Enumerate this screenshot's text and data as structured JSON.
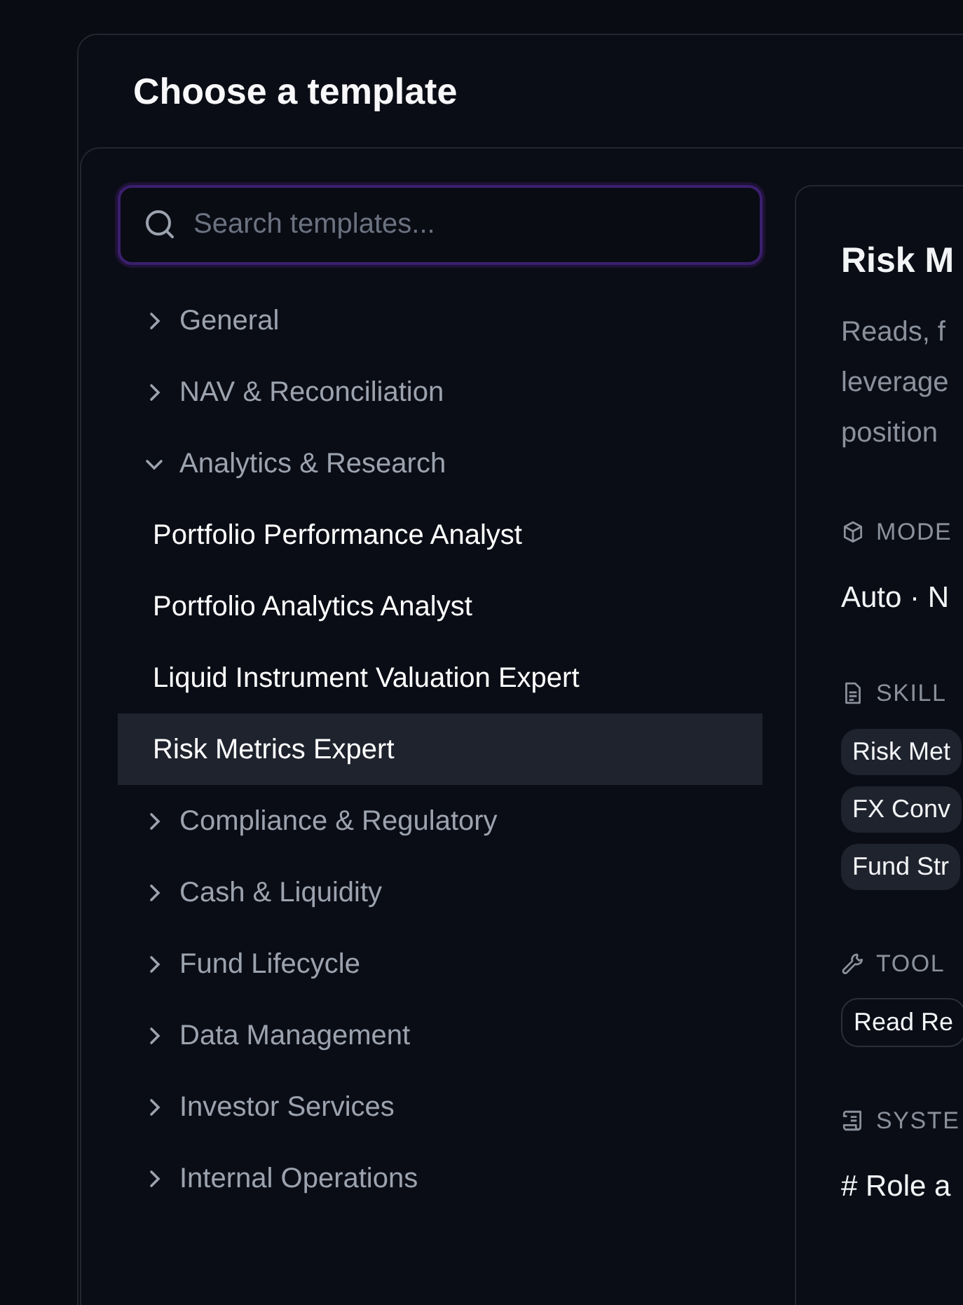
{
  "dialog": {
    "title": "Choose a template"
  },
  "search": {
    "placeholder": "Search templates..."
  },
  "tree": [
    {
      "label": "General",
      "expanded": false
    },
    {
      "label": "NAV & Reconciliation",
      "expanded": false
    },
    {
      "label": "Analytics & Research",
      "expanded": true,
      "children": [
        {
          "label": "Portfolio Performance Analyst",
          "selected": false
        },
        {
          "label": "Portfolio Analytics Analyst",
          "selected": false
        },
        {
          "label": "Liquid Instrument Valuation Expert",
          "selected": false
        },
        {
          "label": "Risk Metrics Expert",
          "selected": true
        }
      ]
    },
    {
      "label": "Compliance & Regulatory",
      "expanded": false
    },
    {
      "label": "Cash & Liquidity",
      "expanded": false
    },
    {
      "label": "Fund Lifecycle",
      "expanded": false
    },
    {
      "label": "Data Management",
      "expanded": false
    },
    {
      "label": "Investor Services",
      "expanded": false
    },
    {
      "label": "Internal Operations",
      "expanded": false
    }
  ],
  "detail": {
    "title": "Risk M",
    "description": [
      "Reads, f",
      "leverage",
      "position"
    ],
    "sections": [
      {
        "kind": "model",
        "label": "MODE",
        "value": "Auto · N"
      },
      {
        "kind": "skills",
        "label": "SKILL",
        "chips": [
          "Risk Met",
          "FX Conv",
          "Fund Str"
        ]
      },
      {
        "kind": "tools",
        "label": "TOOL",
        "chips": [
          "Read Re"
        ]
      },
      {
        "kind": "system",
        "label": "SYSTE",
        "value": "# Role a"
      }
    ]
  }
}
